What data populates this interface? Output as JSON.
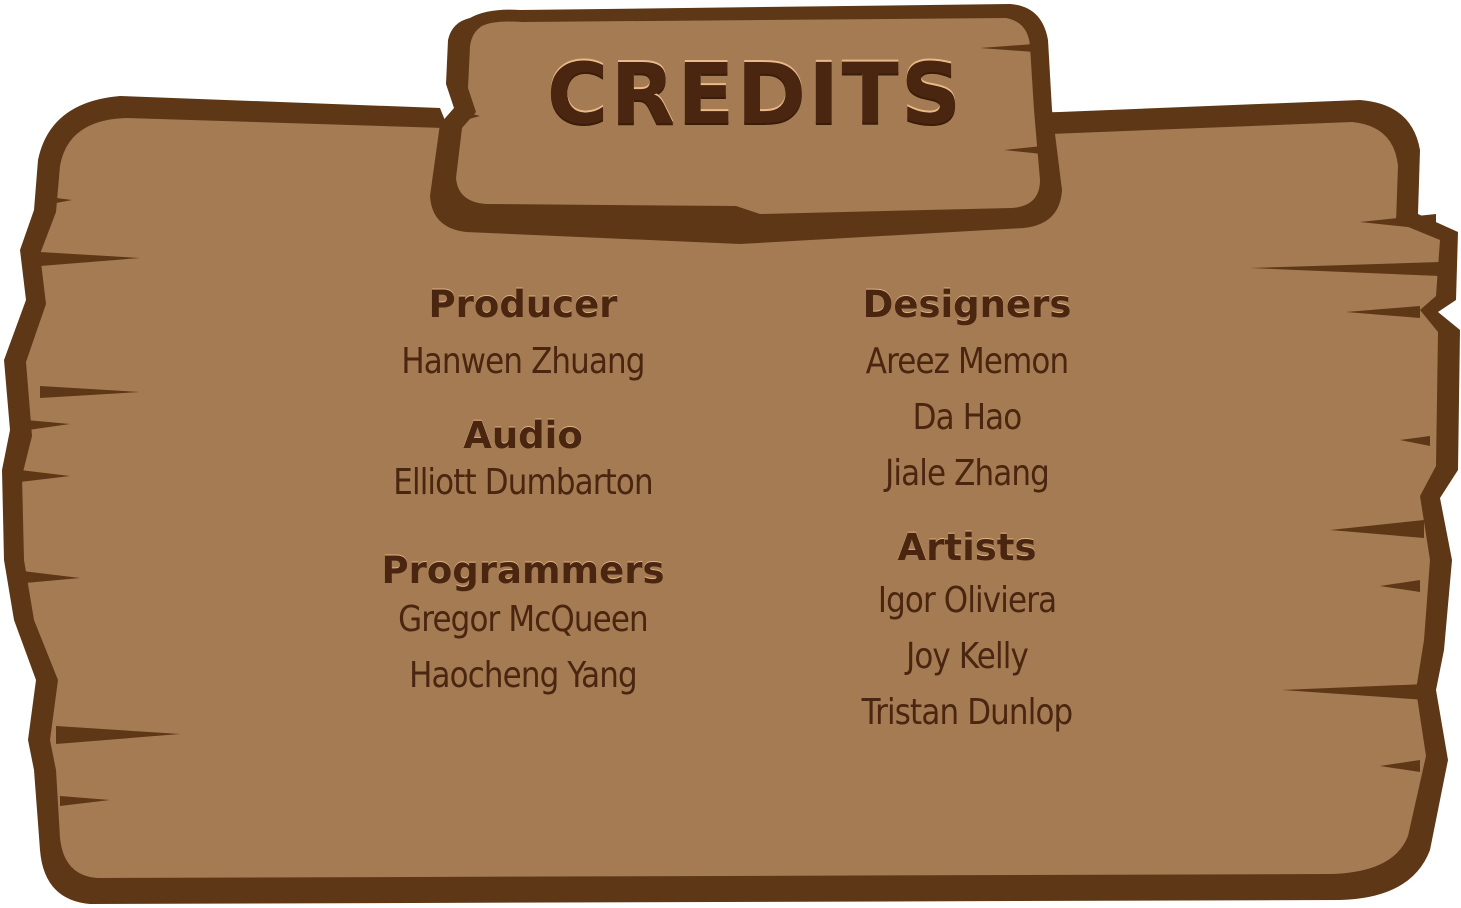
{
  "title": "CREDITS",
  "colors": {
    "board_fill": "#a47b52",
    "board_outline": "#5e3716",
    "text": "#4a2510",
    "highlight": "#e9b98a"
  },
  "left_column": {
    "producer": {
      "heading": "Producer",
      "names": [
        "Hanwen Zhuang"
      ]
    },
    "audio": {
      "heading": "Audio",
      "names": [
        "Elliott Dumbarton"
      ]
    },
    "programmers": {
      "heading": "Programmers",
      "names": [
        "Gregor McQueen",
        "Haocheng Yang"
      ]
    }
  },
  "right_column": {
    "designers": {
      "heading": "Designers",
      "names": [
        "Areez Memon",
        "Da Hao",
        "Jiale Zhang"
      ]
    },
    "artists": {
      "heading": "Artists",
      "names": [
        "Igor Oliviera",
        "Joy Kelly",
        "Tristan Dunlop"
      ]
    }
  }
}
